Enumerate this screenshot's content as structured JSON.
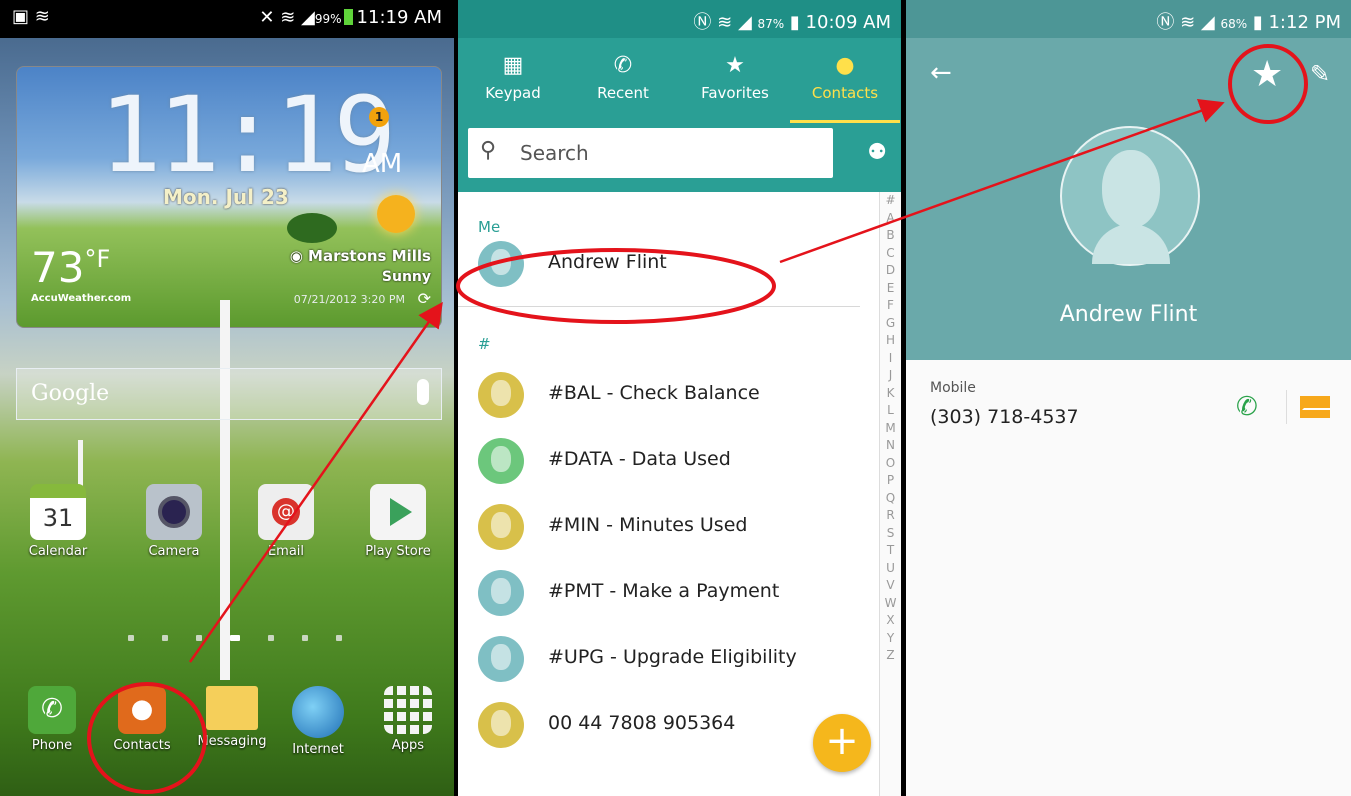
{
  "panel1": {
    "status": {
      "time": "11:19 AM",
      "battery": "99%"
    },
    "widget": {
      "time": "11:19",
      "ampm": "AM",
      "date": "Mon. Jul 23",
      "temp": "73",
      "temp_unit": "°F",
      "location": "Marstons Mills",
      "condition": "Sunny",
      "brand": "AccuWeather.com",
      "updated": "07/21/2012 3:20 PM",
      "alert_badge": "1"
    },
    "google_search": {
      "label": "Google"
    },
    "apps_row": [
      "Calendar",
      "Camera",
      "Email",
      "Play Store"
    ],
    "calendar_day": "31",
    "dock": [
      "Phone",
      "Contacts",
      "Messaging",
      "Internet",
      "Apps"
    ]
  },
  "panel2": {
    "status": {
      "time": "10:09 AM",
      "battery": "87%"
    },
    "tabs": [
      {
        "label": "Keypad",
        "icon": "keypad-icon"
      },
      {
        "label": "Recent",
        "icon": "recent-calls-icon"
      },
      {
        "label": "Favorites",
        "icon": "star-icon"
      },
      {
        "label": "Contacts",
        "icon": "person-icon"
      }
    ],
    "search_placeholder": "Search",
    "section_me": "Me",
    "me_name": "Andrew Flint",
    "section_hash": "#",
    "contacts": [
      {
        "name": "#BAL - Check Balance",
        "color": "#d8c04a"
      },
      {
        "name": "#DATA - Data Used",
        "color": "#6cc77c"
      },
      {
        "name": "#MIN - Minutes Used",
        "color": "#d8c04a"
      },
      {
        "name": "#PMT - Make a Payment",
        "color": "#7fbfc4"
      },
      {
        "name": "#UPG - Upgrade Eligibility",
        "color": "#7fbfc4"
      },
      {
        "name": "00 44 7808 905364",
        "color": "#d8c04a"
      }
    ],
    "index_letters": [
      "#",
      "A",
      "B",
      "C",
      "D",
      "E",
      "F",
      "G",
      "H",
      "I",
      "J",
      "K",
      "L",
      "M",
      "N",
      "O",
      "P",
      "Q",
      "R",
      "S",
      "T",
      "U",
      "V",
      "W",
      "X",
      "Y",
      "Z"
    ],
    "fab": "+"
  },
  "panel3": {
    "status": {
      "time": "1:12 PM",
      "battery": "68%"
    },
    "name": "Andrew Flint",
    "phone_type": "Mobile",
    "phone_number": "(303) 718-4537"
  },
  "colors": {
    "annotation": "#e4131b",
    "teal": "#2a9f95",
    "accent_yellow": "#ffe04a"
  }
}
